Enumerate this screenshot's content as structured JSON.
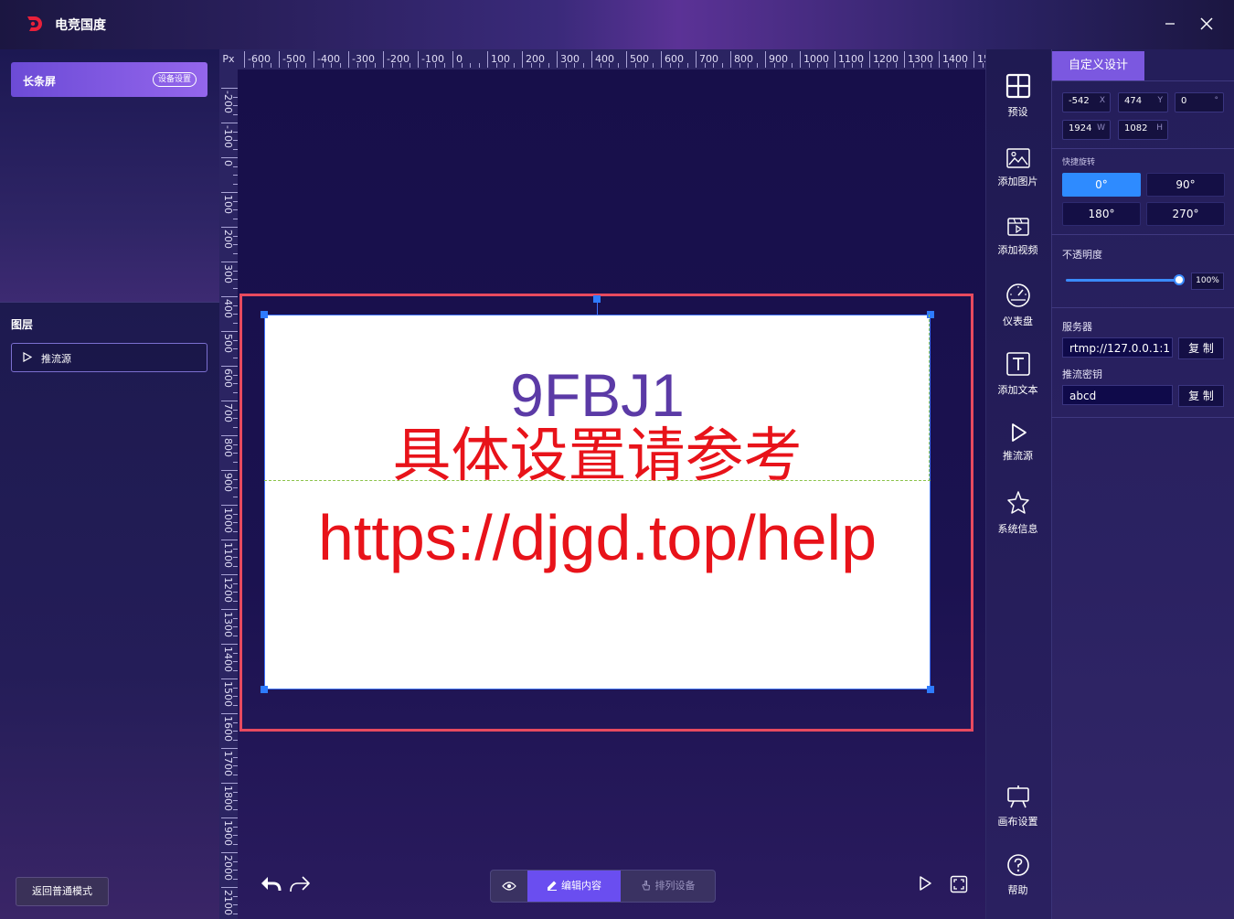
{
  "app": {
    "title": "电竞国度"
  },
  "left": {
    "screen_name": "长条屏",
    "device_settings": "设备设置",
    "layers_title": "图层",
    "layers": [
      {
        "label": "推流源"
      }
    ],
    "back_button": "返回普通模式"
  },
  "ruler": {
    "unit": "Px",
    "top_labels": [
      "-600",
      "-500",
      "-400",
      "-300",
      "-200",
      "-100",
      "0",
      "100",
      "200",
      "300",
      "400",
      "500",
      "600",
      "700",
      "800",
      "900",
      "1000",
      "1100",
      "1200",
      "1300",
      "1400",
      "15"
    ],
    "left_labels": [
      "-200",
      "-100",
      "0",
      "100",
      "200",
      "300",
      "400",
      "500",
      "600",
      "700",
      "800",
      "900",
      "1000",
      "1100",
      "1200",
      "1300",
      "1400",
      "1500",
      "1600",
      "1700",
      "1800",
      "1900",
      "2000",
      "2100"
    ]
  },
  "canvas": {
    "code": "9FBJ1",
    "hint": "具体设置请参考",
    "url": "https://djgd.top/help"
  },
  "bottom": {
    "edit": "编辑内容",
    "arrange": "排列设备"
  },
  "tools": [
    {
      "label": "预设",
      "icon": "grid-icon"
    },
    {
      "label": "添加图片",
      "icon": "image-icon"
    },
    {
      "label": "添加视频",
      "icon": "video-icon"
    },
    {
      "label": "仪表盘",
      "icon": "gauge-icon"
    },
    {
      "label": "添加文本",
      "icon": "text-icon"
    },
    {
      "label": "推流源",
      "icon": "play-icon"
    },
    {
      "label": "系统信息",
      "icon": "star-icon"
    },
    {
      "label": "画布设置",
      "icon": "easel-icon"
    },
    {
      "label": "帮助",
      "icon": "help-icon"
    }
  ],
  "right": {
    "tab": "自定义设计",
    "x": {
      "value": "-542",
      "unit": "X"
    },
    "y": {
      "value": "474",
      "unit": "Y"
    },
    "rotation": {
      "value": "0",
      "unit": "°"
    },
    "w": {
      "value": "1924",
      "unit": "W"
    },
    "h": {
      "value": "1082",
      "unit": "H"
    },
    "quick_rotate": "快捷旋转",
    "rot_options": [
      "0°",
      "90°",
      "180°",
      "270°"
    ],
    "opacity_label": "不透明度",
    "opacity_value": 1.0,
    "opacity_text": "100%",
    "server_label": "服务器",
    "server_value": "rtmp://127.0.0.1:1",
    "key_label": "推流密钥",
    "key_value": "abcd",
    "copy": "复 制"
  }
}
